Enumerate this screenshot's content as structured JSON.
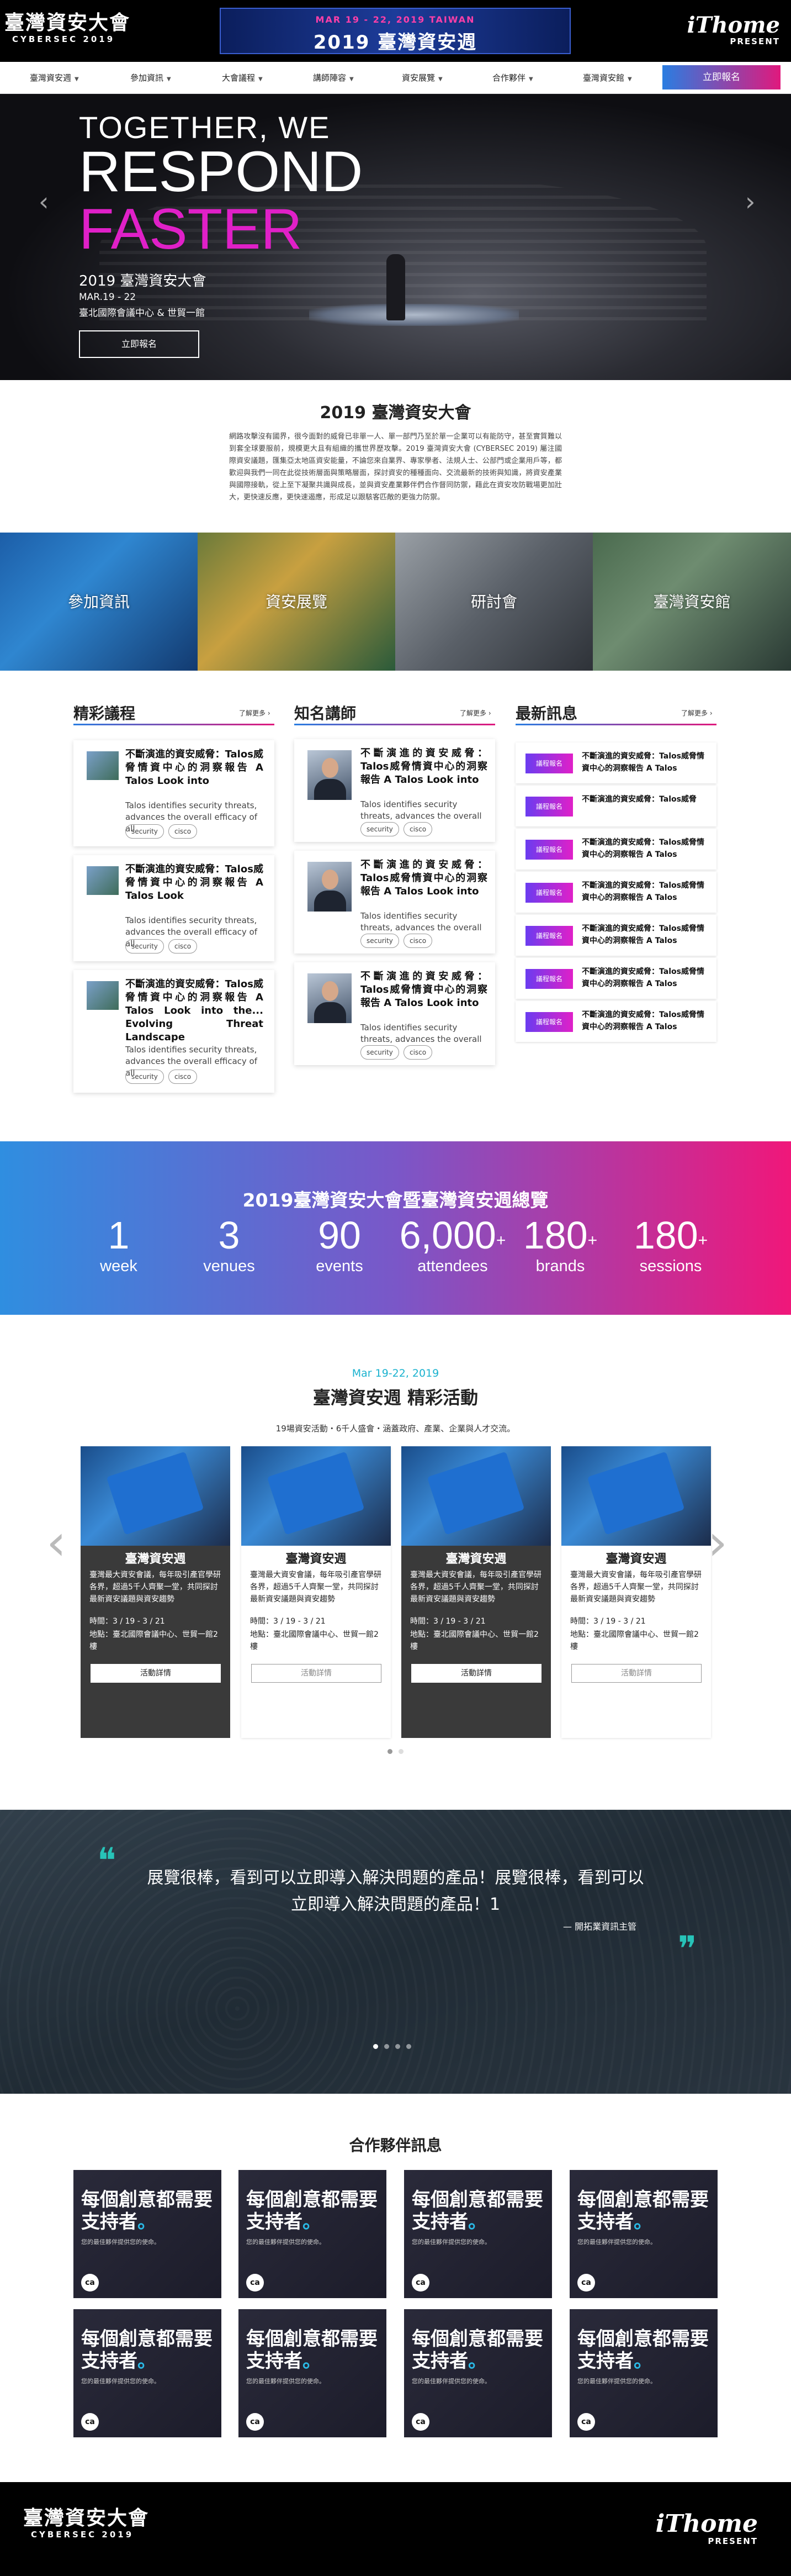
{
  "header": {
    "logo_zh": "臺灣資安大會",
    "logo_en": "CYBERSEC 2019",
    "banner_line1": "MAR 19 - 22, 2019 TAIWAN",
    "banner_line2": "2019 臺灣資安週",
    "ithome": "iThome",
    "ithome_sub": "PRESENT"
  },
  "nav": {
    "items": [
      "臺灣資安週",
      "參加資訊",
      "大會議程",
      "講師陣容",
      "資安展覽",
      "合作夥伴",
      "臺灣資安館"
    ],
    "register": "立即報名"
  },
  "hero": {
    "line1": "TOGETHER, WE",
    "line2": "RESPOND",
    "line3": "FASTER",
    "event": "2019 臺灣資安大會",
    "date": "MAR.19 - 22",
    "venue": "臺北國際會議中心 & 世貿一館",
    "button": "立即報名",
    "prev": "‹",
    "next": "›"
  },
  "intro": {
    "title": "2019 臺灣資安大會",
    "text": "網路攻擊沒有國界，很今面對的威脅已非單一人、單一部門乃至於單一企業可以有能防守，甚至實質難以到套全球要服前，規模更大且有組織的攜世界歷攻擊。2019 臺灣資安大會 (CYBERSEC 2019) 屬注國際資安議題，匯集亞太地區資安能量，不論您來自業界、專家學者、法規人士、公部門或企業用戶等，都歡迎與我們一同在此從技術層面與策略層面，探討資安的種種面向、交流最新的技術與知識，將資安產業與國際接軌，從上至下凝聚共識與成長，並與資安產業夥伴們合作督同防禦，藉此在資安攻防戰場更加壯大，更快速反應，更快速遏應，形成足以跟駭客匹敵的更強力防禦。"
  },
  "tiles": [
    "參加資訊",
    "資安展覽",
    "研討會",
    "臺灣資安館"
  ],
  "sections": {
    "agenda": {
      "title": "精彩議程",
      "more": "了解更多 ›",
      "items": [
        {
          "title": "不斷演進的資安威脅：Talos威脅情資中心的洞察報告 A Talos Look into",
          "desc": "Talos identifies security threats, advances the overall efficacy of all",
          "tags": [
            "security",
            "cisco"
          ]
        },
        {
          "title": "不斷演進的資安威脅：Talos威脅情資中心的洞察報告 A Talos Look",
          "desc": "Talos identifies security threats, advances the overall efficacy of all",
          "tags": [
            "security",
            "cisco"
          ]
        },
        {
          "title": "不斷演進的資安威脅：Talos威脅情資中心的洞察報告 A Talos Look into the... Evolving Threat Landscape",
          "desc": "Talos identifies security threats, advances the overall efficacy of all",
          "tags": [
            "security",
            "cisco"
          ]
        }
      ]
    },
    "speakers": {
      "title": "知名講師",
      "more": "了解更多 ›",
      "items": [
        {
          "title": "不斷演進的資安威脅：Talos威脅情資中心的洞察報告 A Talos Look into",
          "desc": "Talos identifies security threats, advances the overall",
          "tags": [
            "security",
            "cisco"
          ]
        },
        {
          "title": "不斷演進的資安威脅：Talos威脅情資中心的洞察報告 A Talos Look into",
          "desc": "Talos identifies security threats, advances the overall",
          "tags": [
            "security",
            "cisco"
          ]
        },
        {
          "title": "不斷演進的資安威脅：Talos威脅情資中心的洞察報告 A Talos Look into",
          "desc": "Talos identifies security threats, advances the overall",
          "tags": [
            "security",
            "cisco"
          ]
        }
      ]
    },
    "news": {
      "title": "最新訊息",
      "more": "了解更多 ›",
      "badge": "議程報名",
      "items": [
        "不斷演進的資安威脅：Talos威脅情資中心的洞察報告 A Talos",
        "不斷演進的資安威脅：Talos威脅",
        "不斷演進的資安威脅：Talos威脅情資中心的洞察報告 A Talos",
        "不斷演進的資安威脅：Talos威脅情資中心的洞察報告 A Talos",
        "不斷演進的資安威脅：Talos威脅情資中心的洞察報告 A Talos",
        "不斷演進的資安威脅：Talos威脅情資中心的洞察報告 A Talos",
        "不斷演進的資安威脅：Talos威脅情資中心的洞察報告 A Talos"
      ]
    }
  },
  "stats": {
    "title": "2019臺灣資安大會暨臺灣資安週總覽",
    "items": [
      {
        "n": "1",
        "plus": "",
        "l": "week"
      },
      {
        "n": "3",
        "plus": "",
        "l": "venues"
      },
      {
        "n": "90",
        "plus": "",
        "l": "events"
      },
      {
        "n": "6,000",
        "plus": "+",
        "l": "attendees"
      },
      {
        "n": "180",
        "plus": "+",
        "l": "brands"
      },
      {
        "n": "180",
        "plus": "+",
        "l": "sessions"
      }
    ]
  },
  "events": {
    "date": "Mar 19-22, 2019",
    "title": "臺灣資安週 精彩活動",
    "subtitle": "19場資安活動・6千人盛會・涵蓋政府、產業、企業與人才交流。",
    "items": [
      {
        "title": "臺灣資安週",
        "desc": "臺灣最大資安會議，每年吸引產官學研各界，超過5千人齊聚一堂，共同探討最新資安議題與資安趨勢",
        "time": "時間：3 / 19 - 3 / 21",
        "loc": "地點：臺北國際會議中心、世貿一館2樓",
        "btn": "活動詳情"
      },
      {
        "title": "臺灣資安週",
        "desc": "臺灣最大資安會議，每年吸引產官學研各界，超過5千人齊聚一堂，共同探討最新資安議題與資安趨勢",
        "time": "時間：3 / 19 - 3 / 21",
        "loc": "地點：臺北國際會議中心、世貿一館2樓",
        "btn": "活動詳情"
      },
      {
        "title": "臺灣資安週",
        "desc": "臺灣最大資安會議，每年吸引產官學研各界，超過5千人齊聚一堂，共同探討最新資安議題與資安趨勢",
        "time": "時間：3 / 19 - 3 / 21",
        "loc": "地點：臺北國際會議中心、世貿一館2樓",
        "btn": "活動詳情"
      },
      {
        "title": "臺灣資安週",
        "desc": "臺灣最大資安會議，每年吸引產官學研各界，超過5千人齊聚一堂，共同探討最新資安議題與資安趨勢",
        "time": "時間：3 / 19 - 3 / 21",
        "loc": "地點：臺北國際會議中心、世貿一館2樓",
        "btn": "活動詳情"
      }
    ],
    "prev": "‹",
    "next": "›"
  },
  "testimonial": {
    "quote1": "展覽很棒，看到可以立即導入解決問題的產品！展覽很棒，看到可以",
    "quote2": "立即導入解決問題的產品！1",
    "author": "— 開拓業資訊主管",
    "open_mark": "❝",
    "close_mark": "❞"
  },
  "partners": {
    "title": "合作夥伴訊息",
    "headline1": "每個創意都需要",
    "headline2": "支持者",
    "accent": "。",
    "sub": "您的最佳夥伴提供您的使命。",
    "logo": "ca"
  },
  "footer": {
    "logo_zh": "臺灣資安大會",
    "logo_en": "CYBERSEC 2019",
    "ithome": "iThome",
    "ithome_sub": "PRESENT"
  },
  "colors": {
    "accent_gradient_start": "#2a7de1",
    "accent_gradient_end": "#e0197d",
    "hero_magenta": "#e020c8",
    "event_date_teal": "#1ab2cf",
    "quote_teal": "#27c3b8"
  }
}
